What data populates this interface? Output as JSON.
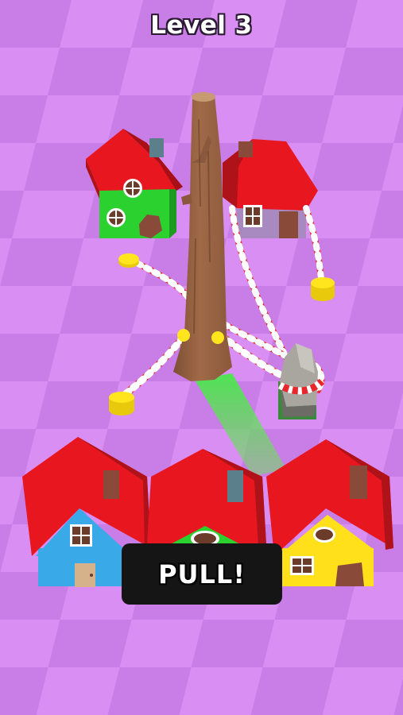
{
  "hud": {
    "level_label": "Level 3"
  },
  "actions": {
    "pull_label": "PULL!"
  },
  "colors": {
    "background_light": "#d68cf0",
    "background_dark": "#c97ce6",
    "roof": "#e8161f",
    "house_green": "#2bd12f",
    "house_purple": "#a98ac0",
    "house_blue": "#3aa9e8",
    "house_yellow": "#ffe01a",
    "trunk": "#9a6444",
    "rope_red": "#e8262b",
    "rope_white": "#ffffff",
    "peg": "#ffe51e",
    "rock": "#a9a6a0",
    "beam": "#4ee84a"
  },
  "icons": [
    "tree-trunk-icon",
    "rock-icon",
    "peg-icon",
    "rope-icon"
  ]
}
